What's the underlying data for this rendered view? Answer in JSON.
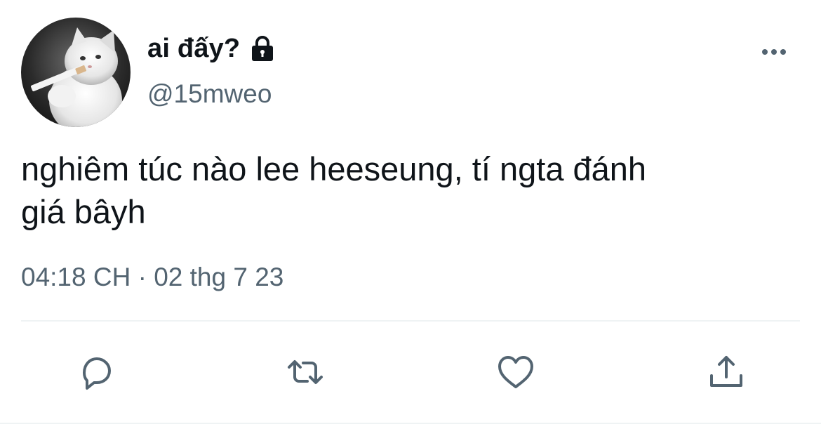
{
  "tweet": {
    "display_name": "ai đấy?",
    "handle": "@15mweo",
    "text": "nghiêm túc nào lee heeseung, tí ngta đánh\ngiá bâyh",
    "timestamp": "04:18 CH · 02 thg 7 23"
  },
  "icons": {
    "verified_lock": "lock-icon",
    "more": "more-icon",
    "reply": "reply-icon",
    "retweet": "retweet-icon",
    "like": "heart-icon",
    "share": "share-icon"
  },
  "colors": {
    "text_primary": "#0f1419",
    "text_secondary": "#536471",
    "icon": "#536471",
    "divider": "#eff3f4"
  }
}
